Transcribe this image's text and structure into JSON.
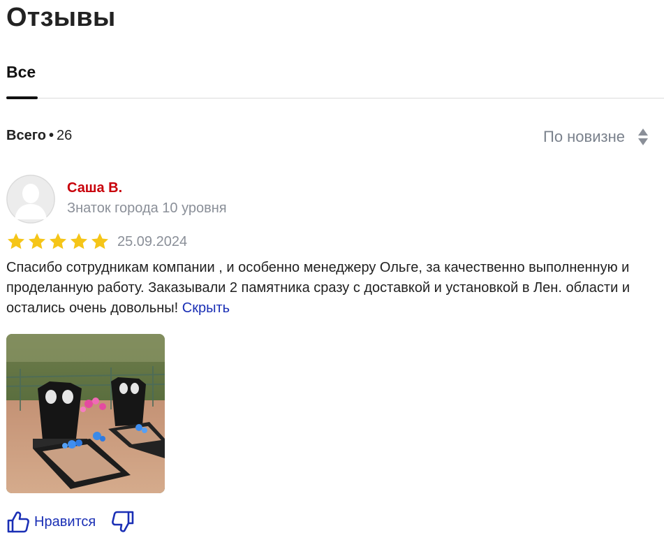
{
  "header": {
    "title": "Отзывы"
  },
  "tabs": [
    {
      "label": "Все",
      "active": true
    }
  ],
  "summary": {
    "label": "Всего",
    "separator": "•",
    "count": "26"
  },
  "sort": {
    "label": "По новизне",
    "icon": "sort-arrows-icon"
  },
  "review": {
    "author": {
      "name": "Саша В.",
      "level": "Знаток города 10 уровня",
      "avatar_icon": "default-avatar-icon"
    },
    "rating": 5,
    "date": "25.09.2024",
    "text": "Спасибо сотрудникам компании , и особенно менеджеру Ольге, за качественно выполненную и проделанную работу. Заказывали 2 памятника сразу с доставкой и установкой в Лен. области и остались очень довольны!",
    "hide_label": "Скрыть",
    "photo_count": 1,
    "like_label": "Нравится",
    "like_icon": "thumbs-up-icon",
    "dislike_icon": "thumbs-down-icon"
  },
  "colors": {
    "author_name": "#c8000a",
    "link": "#1a2fb5",
    "star": "#f5c518",
    "muted": "#8a8f98"
  }
}
